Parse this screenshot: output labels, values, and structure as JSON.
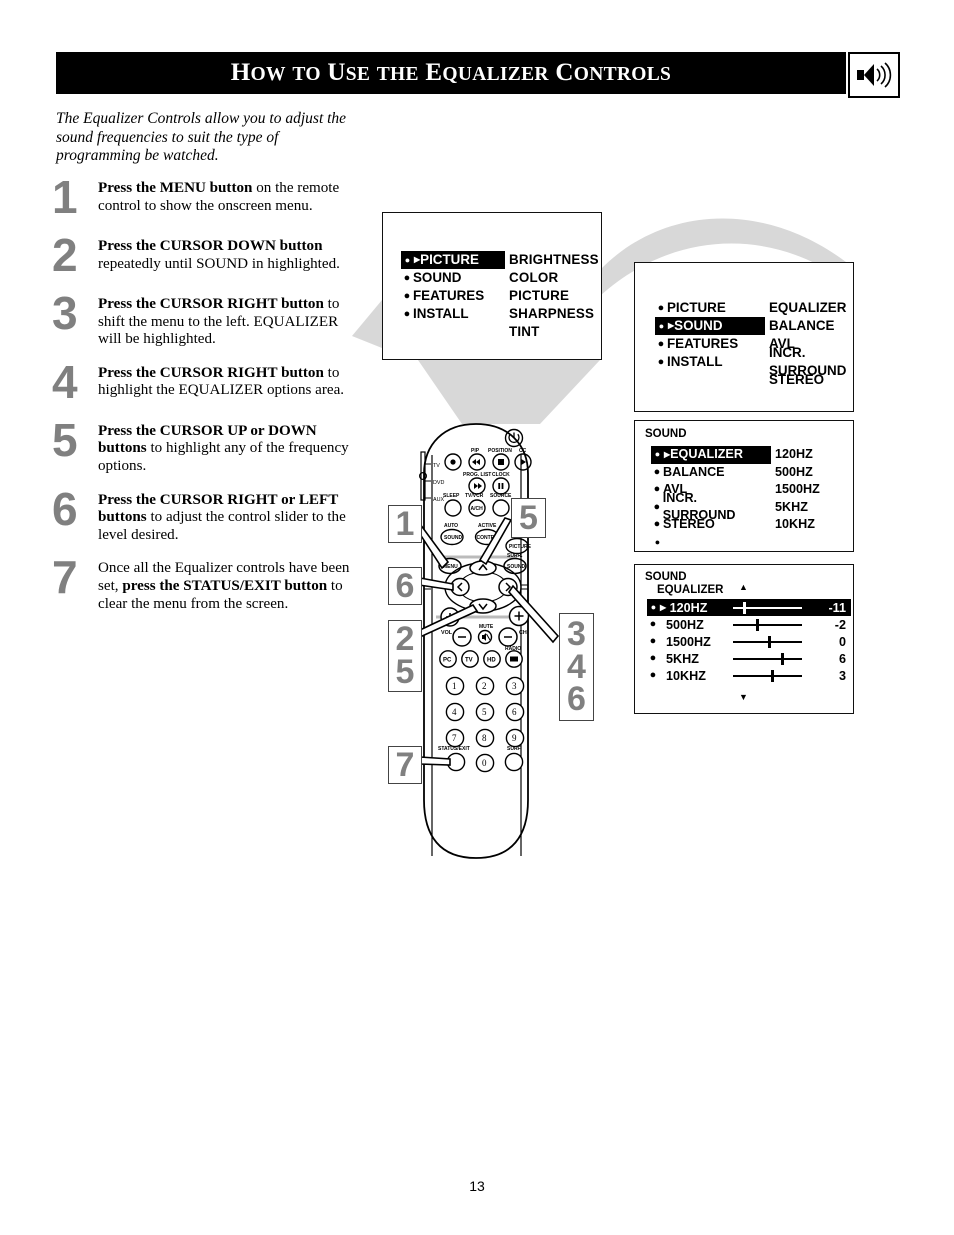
{
  "header": {
    "title_words": [
      "How",
      "to",
      "Use",
      "the",
      "Equalizer",
      "Controls"
    ],
    "title_full": "How to Use the Equalizer Controls",
    "icon": "speaker-sound-icon"
  },
  "intro": "The Equalizer Controls allow you to adjust the sound frequencies to suit the type of programming be watched.",
  "steps": [
    {
      "num": "1",
      "bold": "Press the MENU button",
      "rest": " on the remote control to show the onscreen menu."
    },
    {
      "num": "2",
      "bold": "Press the CURSOR DOWN button",
      "rest": " repeatedly until SOUND in highlighted."
    },
    {
      "num": "3",
      "bold": "Press the CURSOR RIGHT button",
      "rest": " to shift the menu to the left. EQUALIZER will be highlighted."
    },
    {
      "num": "4",
      "bold": "Press the CURSOR RIGHT button",
      "rest": " to highlight the EQUALIZER options area."
    },
    {
      "num": "5",
      "bold": "Press the CURSOR UP or DOWN buttons",
      "rest": " to highlight any of the frequency options."
    },
    {
      "num": "6",
      "bold": "Press the CURSOR RIGHT or LEFT buttons",
      "rest": " to adjust the control slider to the level desired."
    },
    {
      "num": "7",
      "pre": "Once all the Equalizer controls have been set, ",
      "bold": "press the STATUS/EXIT button",
      "rest": " to clear the menu from the screen."
    }
  ],
  "osd1": {
    "menu": [
      {
        "label": "PICTURE",
        "selected": true
      },
      {
        "label": "SOUND",
        "selected": false
      },
      {
        "label": "FEATURES",
        "selected": false
      },
      {
        "label": "INSTALL",
        "selected": false
      }
    ],
    "options": [
      "BRIGHTNESS",
      "COLOR",
      "PICTURE",
      "SHARPNESS",
      "TINT"
    ]
  },
  "osd2": {
    "menu": [
      {
        "label": "PICTURE",
        "selected": false
      },
      {
        "label": "SOUND",
        "selected": true
      },
      {
        "label": "FEATURES",
        "selected": false
      },
      {
        "label": "INSTALL",
        "selected": false
      }
    ],
    "options": [
      "EQUALIZER",
      "BALANCE",
      "AVL",
      "INCR. SURROUND",
      "STEREO"
    ]
  },
  "osd3": {
    "title": "SOUND",
    "menu": [
      {
        "label": "EQUALIZER",
        "selected": true
      },
      {
        "label": "BALANCE",
        "selected": false
      },
      {
        "label": "AVL",
        "selected": false
      },
      {
        "label": "INCR. SURROUND",
        "selected": false
      },
      {
        "label": "STEREO",
        "selected": false
      }
    ],
    "options": [
      "120HZ",
      "500HZ",
      "1500HZ",
      "5KHZ",
      "10KHZ"
    ]
  },
  "osd4": {
    "title": "SOUND",
    "subtitle": "EQUALIZER",
    "rows": [
      {
        "label": "120HZ",
        "value": "-11",
        "pos": 14,
        "selected": true
      },
      {
        "label": "500HZ",
        "value": "-2",
        "pos": 34,
        "selected": false
      },
      {
        "label": "1500HZ",
        "value": "0",
        "pos": 50,
        "selected": false
      },
      {
        "label": "5KHZ",
        "value": "6",
        "pos": 70,
        "selected": false
      },
      {
        "label": "10KHZ",
        "value": "3",
        "pos": 55,
        "selected": false
      }
    ],
    "scroll_up": "▲",
    "scroll_down": "▼"
  },
  "callouts": {
    "left": [
      {
        "id": "callout-1",
        "numbers": [
          "1"
        ]
      },
      {
        "id": "callout-6",
        "numbers": [
          "6"
        ]
      },
      {
        "id": "callout-25",
        "numbers": [
          "2",
          "5"
        ]
      },
      {
        "id": "callout-7",
        "numbers": [
          "7"
        ]
      }
    ],
    "right": [
      {
        "id": "callout-5",
        "numbers": [
          "5"
        ]
      },
      {
        "id": "callout-346",
        "numbers": [
          "3",
          "4",
          "6"
        ]
      }
    ]
  },
  "remote": {
    "side_labels": [
      "TV",
      "DVD",
      "AUX"
    ],
    "top_labels": [
      "PIP",
      "POSITION",
      "CC",
      "PROG. LIST",
      "CLOCK",
      "SLEEP",
      "TV/VCR",
      "SOURCE",
      "A/CH"
    ],
    "feature_labels": [
      "AUTO",
      "SOUND",
      "ACTIVE",
      "CONTROL",
      "MENU",
      "PICTURE",
      "SURR.",
      "SOUND"
    ],
    "vol_label": "VOL",
    "ch_label": "CH",
    "mute_label": "MUTE",
    "radio_label": "RADIO",
    "source_buttons": [
      "PC",
      "TV",
      "HD"
    ],
    "status_label": "STATUS/EXIT",
    "surf_label": "SURF",
    "keypad": [
      "1",
      "2",
      "3",
      "4",
      "5",
      "6",
      "7",
      "8",
      "9",
      "0"
    ]
  },
  "page_number": "13",
  "colors": {
    "header_bg": "#000000",
    "callout_number": "#808080",
    "connector_gray": "#d8d8d8",
    "osd_fg": "#000000"
  }
}
